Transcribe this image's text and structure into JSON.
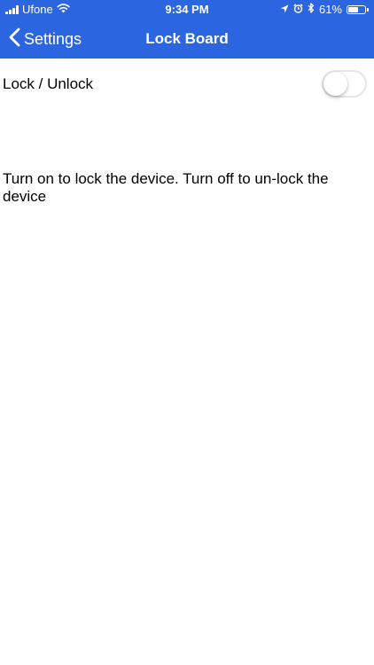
{
  "status_bar": {
    "carrier": "Ufone",
    "time": "9:34 PM",
    "battery_percent": "61%",
    "battery_level": 0.61,
    "icons": [
      "signal-icon",
      "wifi-icon",
      "location-arrow-icon",
      "alarm-icon",
      "bluetooth-icon",
      "battery-icon"
    ]
  },
  "nav": {
    "back_label": "Settings",
    "back_icon": "chevron-left-icon",
    "title": "Lock Board"
  },
  "lock_setting": {
    "label": "Lock / Unlock",
    "enabled": false
  },
  "description": "Turn on to lock the device. Turn off to un-lock the device",
  "colors": {
    "header_bg": "#2b65e0",
    "header_text": "#ffffff",
    "background": "#ffffff",
    "toggle_off_border": "#e5e5ea"
  }
}
